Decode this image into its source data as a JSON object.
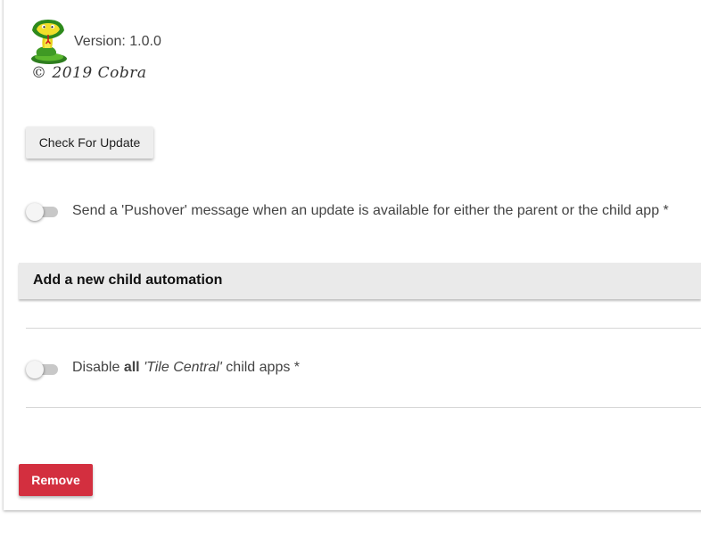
{
  "app": {
    "logo_icon": "cobra-snake-logo-icon",
    "version": "Version: 1.0.0",
    "copyright": "© 2019 Cobra"
  },
  "update": {
    "check_button_label": "Check For Update"
  },
  "pushover": {
    "enabled": false,
    "label": "Send a 'Pushover' message when an update is available for either the parent or the child app *"
  },
  "child_section": {
    "header": "Add a new child automation"
  },
  "disable_all": {
    "enabled": false,
    "label_prefix": "Disable ",
    "label_bold": "all",
    "label_space": " ",
    "label_italic": "'Tile Central'",
    "label_suffix": " child apps *"
  },
  "actions": {
    "remove_button_label": "Remove"
  },
  "colors": {
    "remove_button": "#d32f3f",
    "section_header_bg": "#eaeaea",
    "toggle_track_off": "#c8c8c8"
  }
}
